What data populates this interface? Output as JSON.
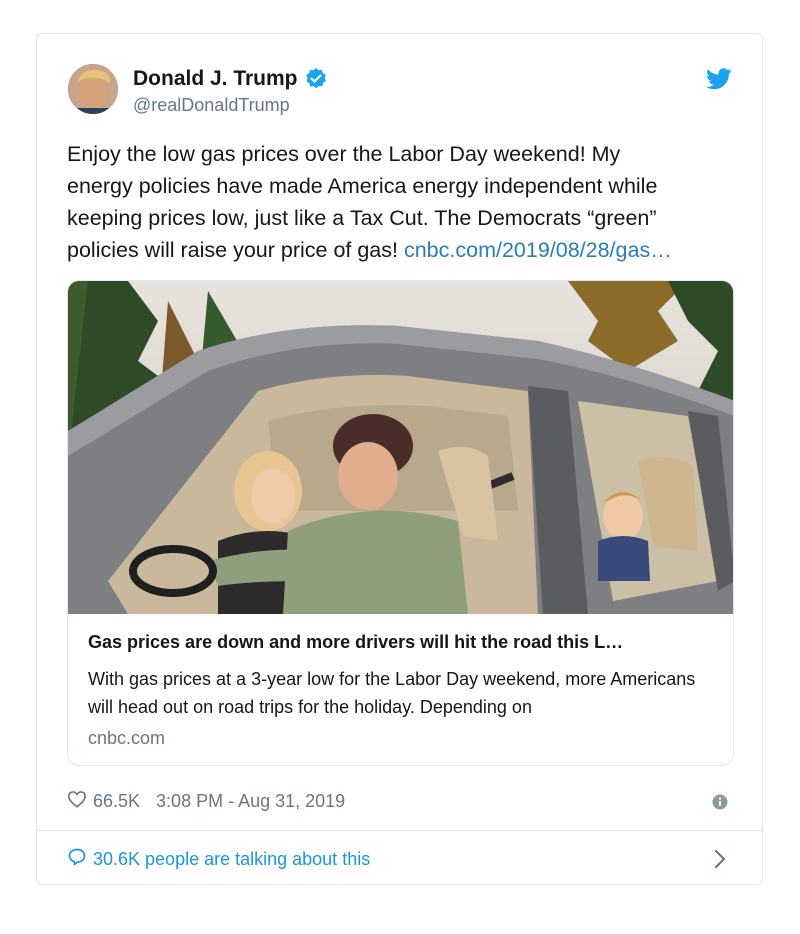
{
  "tweet": {
    "author_name": "Donald J. Trump",
    "author_handle": "@realDonaldTrump",
    "text_line1": "Enjoy the low gas prices over the Labor Day weekend! My",
    "text_line2": "energy policies have made America energy independent while",
    "text_line3": "keeping prices low, just like a Tax Cut. The Democrats “green”",
    "text_line4_prefix": "policies will raise your price of gas! ",
    "link_text": "cnbc.com/2019/08/28/gas…"
  },
  "card": {
    "title": "Gas prices are down and more drivers will hit the road this L…",
    "description": "With gas prices at a 3-year low for the Labor Day weekend, more Americans will head out on road trips for the holiday. Depending on",
    "domain": "cnbc.com"
  },
  "meta": {
    "likes": "66.5K",
    "timestamp": "3:08 PM - Aug 31, 2019"
  },
  "footer": {
    "talking_text": "30.6K people are talking about this"
  },
  "colors": {
    "link": "#2b7bb9",
    "accent": "#1da1f2",
    "secondary_text": "#657786",
    "border": "#e1e8ed"
  },
  "icons": [
    "verified-badge-icon",
    "twitter-bird-icon",
    "heart-icon",
    "info-icon",
    "speech-bubble-icon",
    "chevron-right-icon"
  ]
}
